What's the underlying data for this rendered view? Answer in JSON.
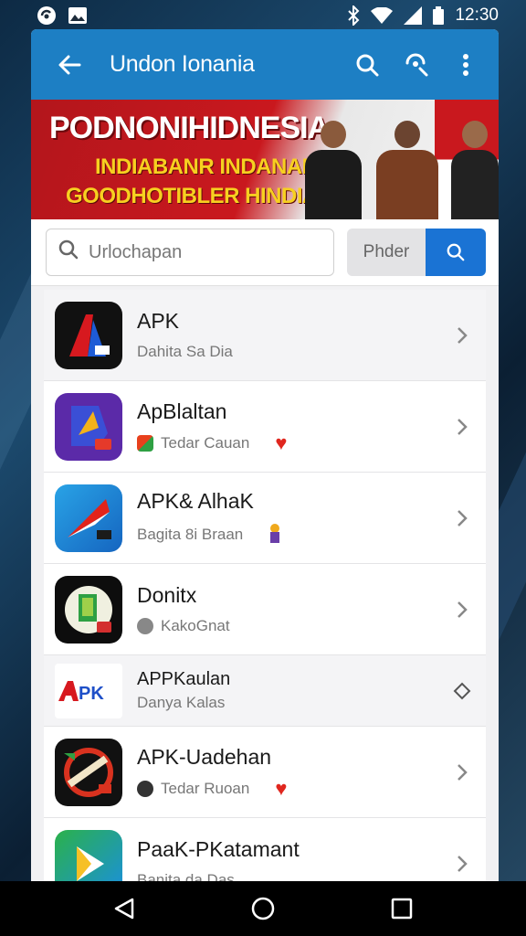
{
  "status_bar": {
    "time": "12:30",
    "left_icons": [
      "sync-icon",
      "image-icon"
    ],
    "right_icons": [
      "bluetooth-icon",
      "wifi-icon",
      "signal-icon",
      "battery-icon"
    ]
  },
  "appbar": {
    "title": "Undon Ionania",
    "background": "#1d7fc4"
  },
  "banner": {
    "headline": "PODNONIHIDNESIA",
    "line1": "INDIABANR INDANANI",
    "line2": "GOODHOTIBLER HINDIAN"
  },
  "search": {
    "placeholder": "Urlochapan",
    "filter_label": "Phder",
    "accent": "#1a73d4"
  },
  "apps": [
    {
      "name": "APK",
      "subtitle": "Dahita Sa Dia",
      "icon": "apk-red-a-icon",
      "heart": false,
      "chevron": "chevron-right"
    },
    {
      "name": "ApBlaltan",
      "subtitle": "Tedar Cauan",
      "icon": "purple-apk-icon",
      "heart": true,
      "chevron": "chevron-right"
    },
    {
      "name": "APK& AlhaK",
      "subtitle": "Bagita 8i Braan",
      "icon": "blue-kite-icon",
      "heart": false,
      "chevron": "chevron-right"
    },
    {
      "name": "Donitx",
      "subtitle": "KakoGnat",
      "icon": "green-doc-icon",
      "heart": false,
      "chevron": "chevron-right"
    },
    {
      "name": "APPKaulan",
      "subtitle": "Danya Kalas",
      "icon": "apk-logo-icon",
      "heart": false,
      "chevron": "diamond"
    },
    {
      "name": "APK-Uadehan",
      "subtitle": "Tedar Ruoan",
      "icon": "circle-stamp-icon",
      "heart": true,
      "chevron": "chevron-right"
    },
    {
      "name": "PaaK-PKatamant",
      "subtitle": "Banita da Das",
      "icon": "play-store-icon",
      "heart": false,
      "chevron": "chevron-right"
    }
  ],
  "nav": [
    "back-icon",
    "home-icon",
    "recents-icon"
  ]
}
